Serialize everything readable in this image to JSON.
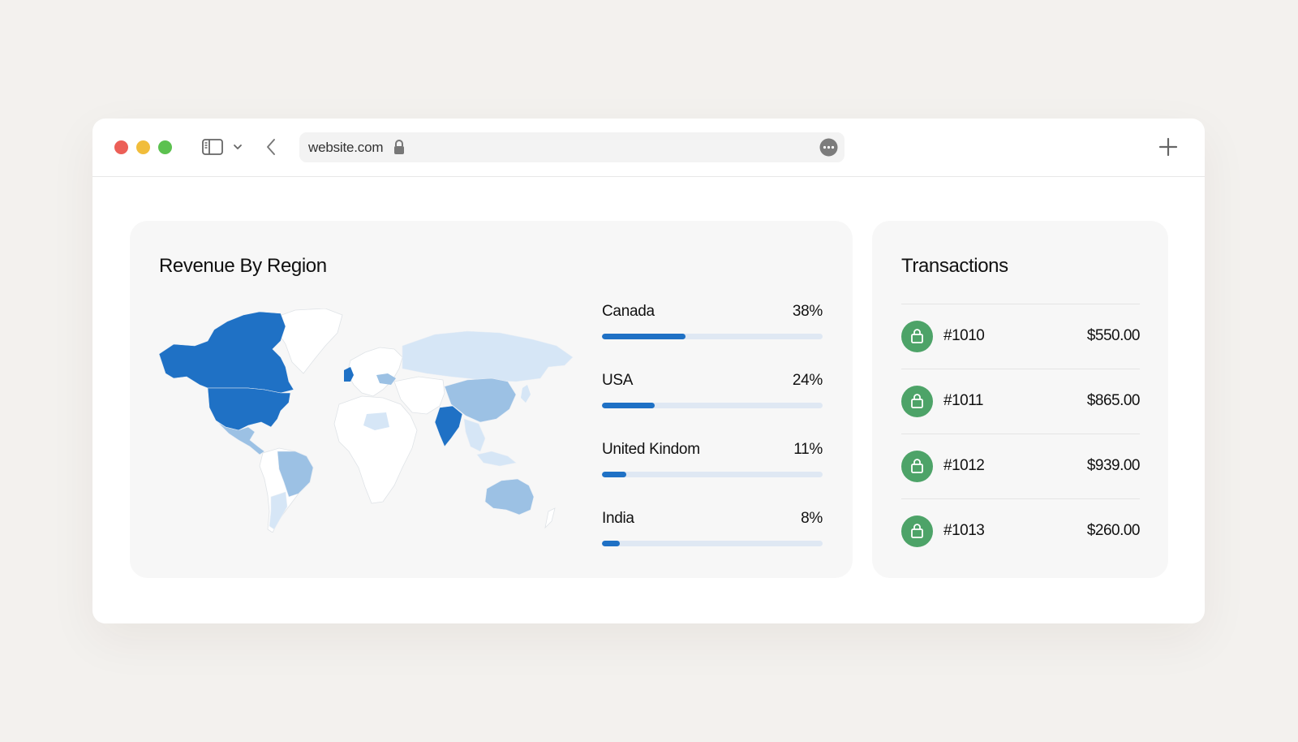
{
  "browser": {
    "url": "website.com",
    "icons": [
      "sidebar-icon",
      "chevron-down-icon",
      "back-arrow-icon",
      "lock-icon",
      "more-icon",
      "plus-icon"
    ]
  },
  "region_card": {
    "title": "Revenue By Region",
    "map_colors": {
      "dark": "#1f71c5",
      "medium": "#9cc1e4",
      "light": "#d6e6f6",
      "empty": "#ffffff"
    },
    "regions": [
      {
        "name": "Canada",
        "percent_label": "38%",
        "share": 0.38
      },
      {
        "name": "USA",
        "percent_label": "24%",
        "share": 0.24
      },
      {
        "name": "United Kindom",
        "percent_label": "11%",
        "share": 0.11
      },
      {
        "name": "India",
        "percent_label": "8%",
        "share": 0.08
      }
    ]
  },
  "transactions_card": {
    "title": "Transactions",
    "badge_color": "#4da368",
    "items": [
      {
        "id": "#1010",
        "amount": "$550.00"
      },
      {
        "id": "#1011",
        "amount": "$865.00"
      },
      {
        "id": "#1012",
        "amount": "$939.00"
      },
      {
        "id": "#1013",
        "amount": "$260.00"
      }
    ]
  }
}
